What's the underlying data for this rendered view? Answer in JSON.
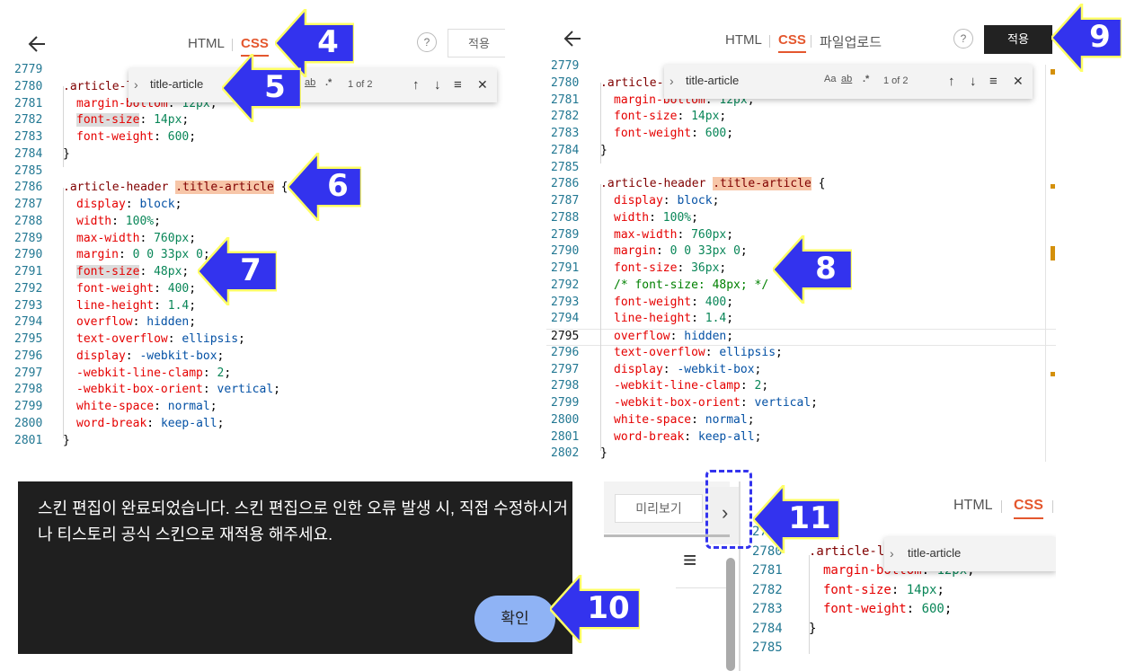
{
  "editor": {
    "tab_html": "HTML",
    "tab_css": "CSS",
    "tab_upload": "파일업로드",
    "help_label": "?",
    "apply_label": "적용"
  },
  "find_widget": {
    "query": "title-article",
    "match_case_icon": "Aa",
    "whole_word_icon": "ab",
    "regex_icon": ".*",
    "count": "1 of 2"
  },
  "panel1": {
    "lines": [
      {
        "n": "2779"
      },
      {
        "n": "2780",
        "t": ".article-l"
      },
      {
        "n": "2781",
        "p": "margin-bottom",
        "v": "12px"
      },
      {
        "n": "2782",
        "p": "font-size",
        "v": "14px"
      },
      {
        "n": "2783",
        "p": "font-weight",
        "v": "600"
      },
      {
        "n": "2784",
        "t": "}"
      },
      {
        "n": "2785"
      },
      {
        "n": "2786",
        "t": ".article-header ",
        "t2": ".title-article",
        "t3": " {"
      },
      {
        "n": "2787",
        "p": "display",
        "v": "block"
      },
      {
        "n": "2788",
        "p": "width",
        "v": "100%"
      },
      {
        "n": "2789",
        "p": "max-width",
        "v": "760px"
      },
      {
        "n": "2790",
        "p": "margin",
        "v": "0 0 33px 0"
      },
      {
        "n": "2791",
        "p": "font-size",
        "v": "48px"
      },
      {
        "n": "2792",
        "p": "font-weight",
        "v": "400"
      },
      {
        "n": "2793",
        "p": "line-height",
        "v": "1.4"
      },
      {
        "n": "2794",
        "p": "overflow",
        "v": "hidden"
      },
      {
        "n": "2795",
        "p": "text-overflow",
        "v": "ellipsis"
      },
      {
        "n": "2796",
        "p": "display",
        "v": "-webkit-box"
      },
      {
        "n": "2797",
        "p": "-webkit-line-clamp",
        "v": "2"
      },
      {
        "n": "2798",
        "p": "-webkit-box-orient",
        "v": "vertical"
      },
      {
        "n": "2799",
        "p": "white-space",
        "v": "normal"
      },
      {
        "n": "2800",
        "p": "word-break",
        "v": "keep-all"
      },
      {
        "n": "2801",
        "t": "}"
      }
    ]
  },
  "panel2": {
    "lines": [
      {
        "n": "2779"
      },
      {
        "n": "2780",
        "t": ".article-l"
      },
      {
        "n": "2781",
        "p": "margin-bottom",
        "v": "12px"
      },
      {
        "n": "2782",
        "p": "font-size",
        "v": "14px"
      },
      {
        "n": "2783",
        "p": "font-weight",
        "v": "600"
      },
      {
        "n": "2784",
        "t": "}"
      },
      {
        "n": "2785"
      },
      {
        "n": "2786",
        "t": ".article-header ",
        "t2": ".title-article",
        "t3": " {"
      },
      {
        "n": "2787",
        "p": "display",
        "v": "block"
      },
      {
        "n": "2788",
        "p": "width",
        "v": "100%"
      },
      {
        "n": "2789",
        "p": "max-width",
        "v": "760px"
      },
      {
        "n": "2790",
        "p": "margin",
        "v": "0 0 33px 0"
      },
      {
        "n": "2791",
        "p": "font-size",
        "v": "36px"
      },
      {
        "n": "2792",
        "c": "/* font-size: 48px; */"
      },
      {
        "n": "2793",
        "p": "font-weight",
        "v": "400"
      },
      {
        "n": "2794",
        "p": "line-height",
        "v": "1.4"
      },
      {
        "n": "2795",
        "p": "overflow",
        "v": "hidden"
      },
      {
        "n": "2796",
        "p": "text-overflow",
        "v": "ellipsis"
      },
      {
        "n": "2797",
        "p": "display",
        "v": "-webkit-box"
      },
      {
        "n": "2798",
        "p": "-webkit-line-clamp",
        "v": "2"
      },
      {
        "n": "2799",
        "p": "-webkit-box-orient",
        "v": "vertical"
      },
      {
        "n": "2800",
        "p": "white-space",
        "v": "normal"
      },
      {
        "n": "2801",
        "p": "word-break",
        "v": "keep-all"
      },
      {
        "n": "2802",
        "t": "}"
      }
    ]
  },
  "panel4": {
    "preview_label": "미리보기",
    "expand_icon": "›",
    "menu_icon": "≡",
    "lines": [
      {
        "n": "2779"
      },
      {
        "n": "2780",
        "t": ".article-l"
      },
      {
        "n": "2781",
        "p": "margin-bottom",
        "v": "12px"
      },
      {
        "n": "2782",
        "p": "font-size",
        "v": "14px"
      },
      {
        "n": "2783",
        "p": "font-weight",
        "v": "600"
      },
      {
        "n": "2784",
        "t": "}"
      },
      {
        "n": "2785"
      }
    ]
  },
  "dialog": {
    "message": "스킨 편집이 완료되었습니다. 스킨 편집으로 인한 오류 발생 시, 직접 수정하시거나 티스토리 공식 스킨으로 재적용 해주세요.",
    "confirm_label": "확인"
  },
  "callouts": [
    "4",
    "5",
    "6",
    "7",
    "8",
    "9",
    "10",
    "11"
  ],
  "colors": {
    "accent": "#e4572e",
    "callout_fill": "#3333ee",
    "callout_border": "#ffff66",
    "dialog_bg": "#1f1f1f",
    "confirm_bg": "#8fb3f5"
  }
}
